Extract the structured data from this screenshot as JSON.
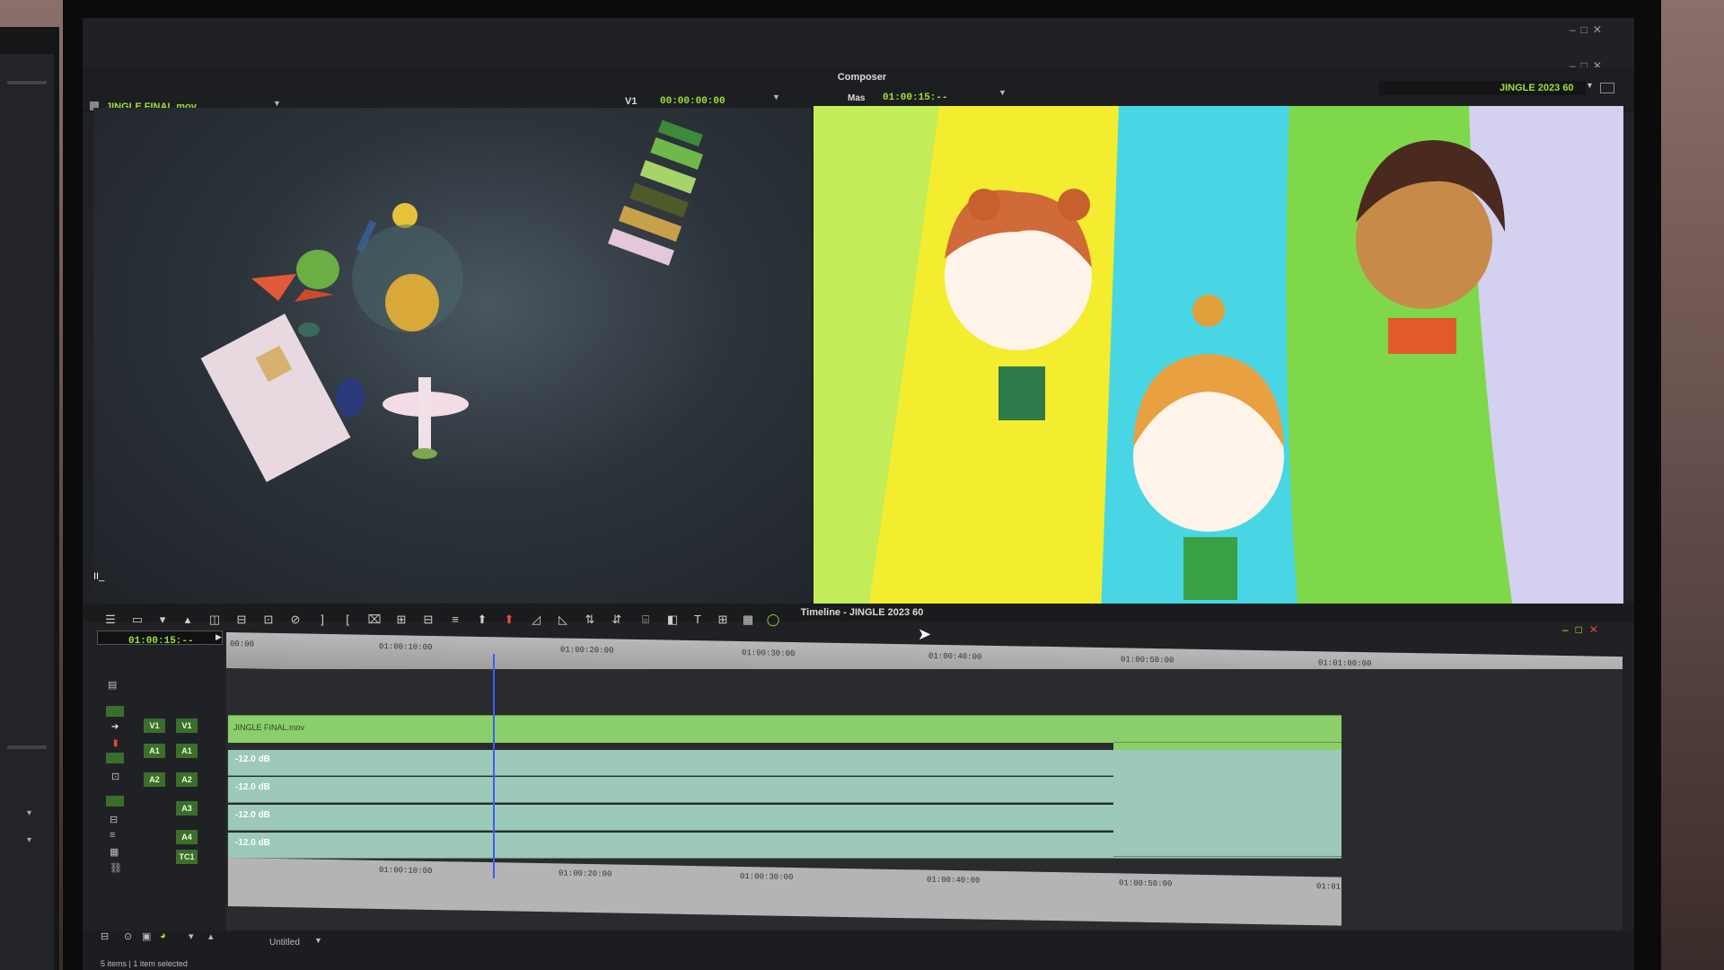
{
  "composer": {
    "title": "Composer",
    "source_clip": "JINGLE FINAL.mov",
    "track_label": "V1",
    "source_timecode": "00:00:00:00",
    "mas_label": "Mas",
    "record_timecode": "01:00:15:--",
    "sequence_name": "JINGLE 2023 60"
  },
  "timeline": {
    "title": "Timeline - JINGLE 2023 60",
    "timecode": "01:00:15:--",
    "ruler_top": [
      "00:00",
      "01:00:10:00",
      "01:00:20:00",
      "01:00:30:00",
      "01:00:40:00",
      "01:00:50:00",
      "01:01:00:00"
    ],
    "ruler_bottom": [
      "01:00:10:00",
      "01:00:20:00",
      "01:00:30:00",
      "01:00:40:00",
      "01:00:50:00",
      "01:01"
    ],
    "tracks": [
      {
        "source": "V1",
        "record": "V1",
        "kind": "video",
        "clip": "JINGLE FINAL.mov"
      },
      {
        "source": "A1",
        "record": "A1",
        "kind": "audio",
        "volume": "-12.0 dB"
      },
      {
        "source": "A2",
        "record": "A2",
        "kind": "audio",
        "volume": "-12.0 dB"
      },
      {
        "source": "",
        "record": "A3",
        "kind": "audio",
        "volume": "-12.0 dB"
      },
      {
        "source": "",
        "record": "A4",
        "kind": "audio",
        "volume": "-12.0 dB"
      },
      {
        "source": "",
        "record": "TC1",
        "kind": "timecode"
      }
    ],
    "playhead_fraction": 0.19
  },
  "bottom": {
    "bin_view": "Untitled",
    "status": "5 items | 1 item selected"
  },
  "colors": {
    "accent_green": "#9fe03a",
    "video_clip": "#8bcf6a",
    "audio_clip": "#9cc9b8",
    "playhead": "#3f5bff"
  }
}
